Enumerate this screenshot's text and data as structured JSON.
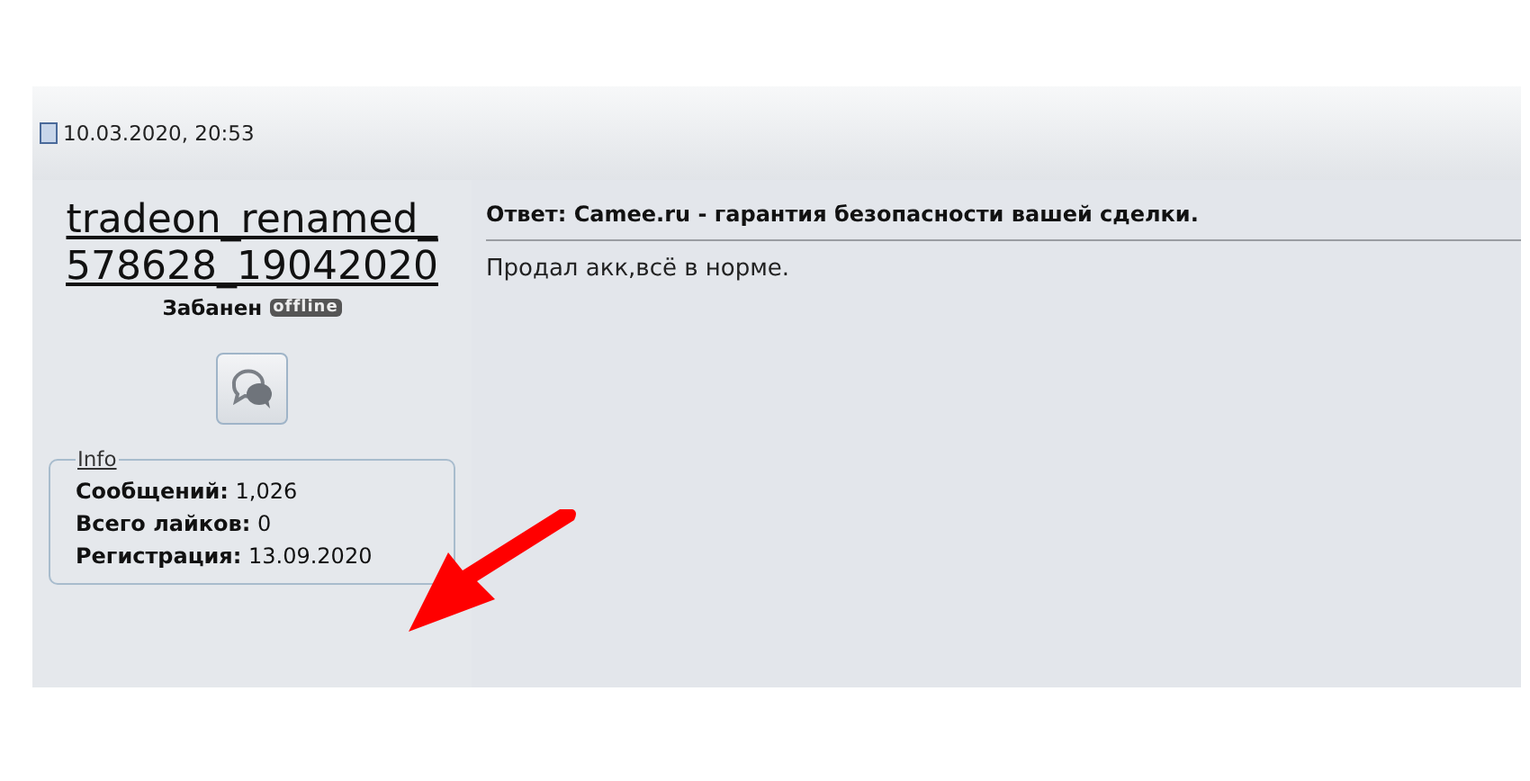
{
  "post_header": {
    "date": "10.03.2020, 20:53"
  },
  "author": {
    "username": "tradeon_renamed_578628_19042020",
    "status": "Забанен",
    "online_badge": "offline"
  },
  "info": {
    "legend": "Info",
    "rows": [
      {
        "label": "Сообщений:",
        "value": "1,026"
      },
      {
        "label": "Всего лайков:",
        "value": "0"
      },
      {
        "label": "Регистрация:",
        "value": "13.09.2020"
      }
    ]
  },
  "post": {
    "title": "Ответ: Camee.ru - гарантия безопасности вашей сделки.",
    "text": "Продал акк,всё в норме."
  }
}
